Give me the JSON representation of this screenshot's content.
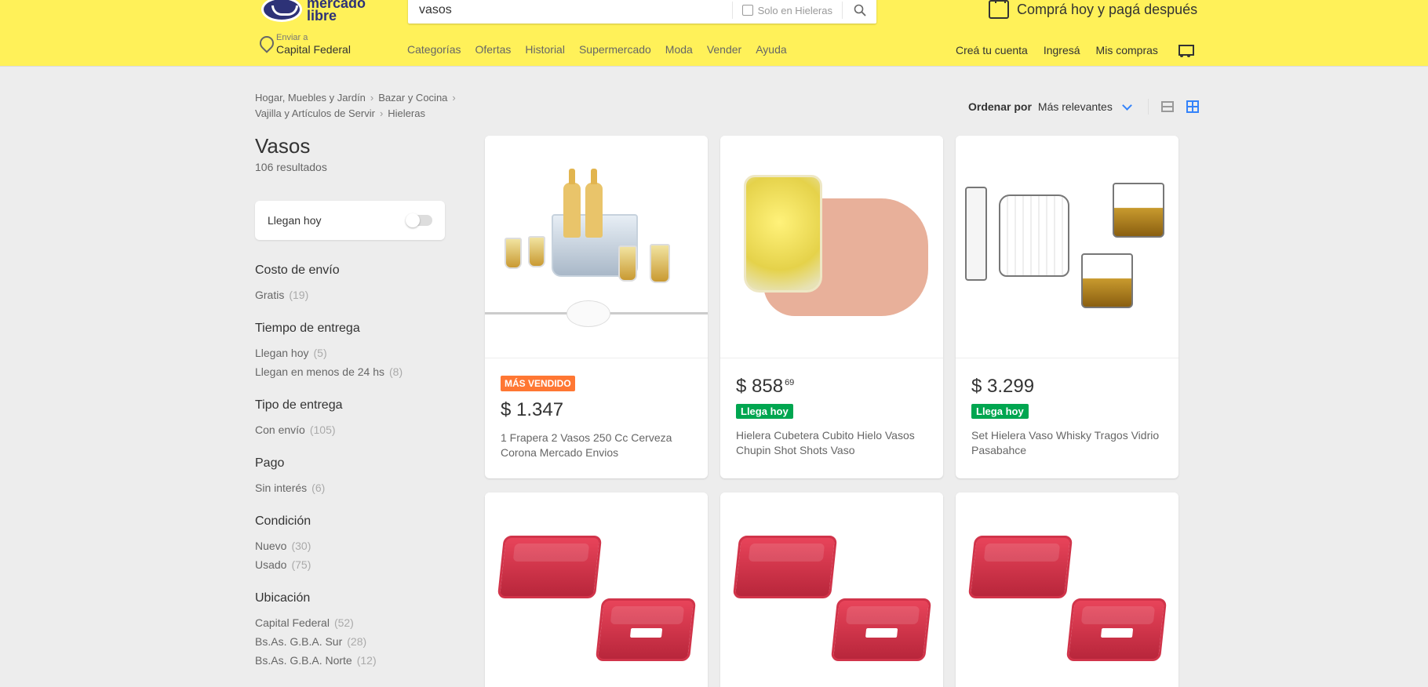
{
  "header": {
    "logo_text": "mercado libre",
    "search": {
      "value": "vasos",
      "option_label": "Solo en Hieleras"
    },
    "promo": "Comprá hoy y pagá después",
    "location": {
      "label": "Enviar a",
      "value": "Capital Federal"
    },
    "nav": [
      "Categorías",
      "Ofertas",
      "Historial",
      "Supermercado",
      "Moda",
      "Vender",
      "Ayuda"
    ],
    "nav_right": [
      "Creá tu cuenta",
      "Ingresá",
      "Mis compras"
    ]
  },
  "breadcrumb": [
    "Hogar, Muebles y Jardín",
    "Bazar y Cocina",
    "Vajilla y Artículos de Servir",
    "Hieleras"
  ],
  "page": {
    "title": "Vasos",
    "results": "106 resultados"
  },
  "toggle": {
    "label": "Llegan hoy"
  },
  "filters": [
    {
      "title": "Costo de envío",
      "items": [
        {
          "label": "Gratis",
          "count": "(19)"
        }
      ]
    },
    {
      "title": "Tiempo de entrega",
      "items": [
        {
          "label": "Llegan hoy",
          "count": "(5)"
        },
        {
          "label": "Llegan en menos de 24 hs",
          "count": "(8)"
        }
      ]
    },
    {
      "title": "Tipo de entrega",
      "items": [
        {
          "label": "Con envío",
          "count": "(105)"
        }
      ]
    },
    {
      "title": "Pago",
      "items": [
        {
          "label": "Sin interés",
          "count": "(6)"
        }
      ]
    },
    {
      "title": "Condición",
      "items": [
        {
          "label": "Nuevo",
          "count": "(30)"
        },
        {
          "label": "Usado",
          "count": "(75)"
        }
      ]
    },
    {
      "title": "Ubicación",
      "items": [
        {
          "label": "Capital Federal",
          "count": "(52)"
        },
        {
          "label": "Bs.As. G.B.A. Sur",
          "count": "(28)"
        },
        {
          "label": "Bs.As. G.B.A. Norte",
          "count": "(12)"
        }
      ]
    }
  ],
  "sort": {
    "label": "Ordenar por",
    "value": "Más relevantes"
  },
  "products": [
    {
      "badge": "MÁS VENDIDO",
      "price": "$ 1.347",
      "cents": "",
      "title": "1 Frapera 2 Vasos 250 Cc Cerveza Corona Mercado Envios"
    },
    {
      "price": "$ 858",
      "cents": "69",
      "tag": "Llega hoy",
      "title": "Hielera Cubetera Cubito Hielo Vasos Chupin Shot Shots Vaso"
    },
    {
      "price": "$ 3.299",
      "cents": "",
      "tag": "Llega hoy",
      "title": "Set Hielera Vaso Whisky Tragos Vidrio Pasabahce"
    }
  ],
  "colors": {
    "header_bg": "#fff159",
    "accent_blue": "#3483fa",
    "badge_orange": "#ff7733",
    "badge_green": "#00a650"
  }
}
